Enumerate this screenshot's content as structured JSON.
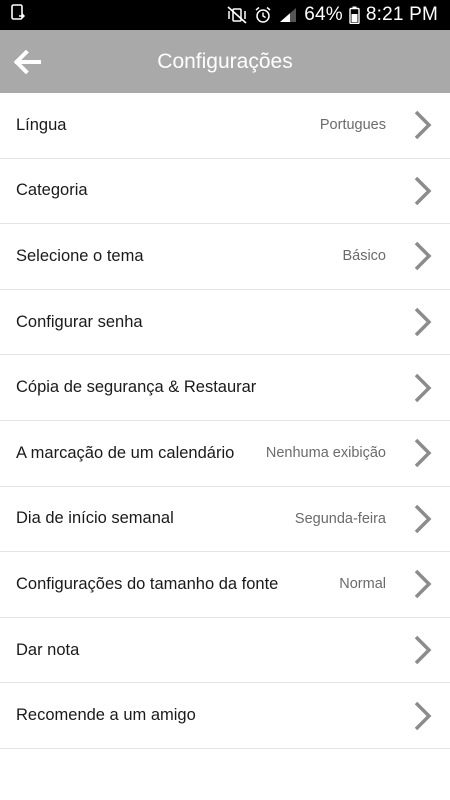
{
  "status_bar": {
    "battery_text": "64%",
    "time": "8:21 PM",
    "icons": [
      "screen-cast-icon",
      "mute-vibrate-icon",
      "alarm-icon",
      "signal-icon",
      "battery-icon"
    ]
  },
  "header": {
    "title": "Configurações",
    "back_icon": "arrow-left-icon",
    "background_color": "#a9a9a9"
  },
  "settings": {
    "items": [
      {
        "label": "Língua",
        "value": "Portugues"
      },
      {
        "label": "Categoria",
        "value": ""
      },
      {
        "label": "Selecione o tema",
        "value": "Básico"
      },
      {
        "label": "Configurar senha",
        "value": ""
      },
      {
        "label": "Cópia de segurança & Restaurar",
        "value": ""
      },
      {
        "label": "A marcação de um calendário",
        "value": "Nenhuma exibição"
      },
      {
        "label": "Dia de início semanal",
        "value": "Segunda-feira"
      },
      {
        "label": "Configurações do tamanho da fonte",
        "value": "Normal"
      },
      {
        "label": "Dar nota",
        "value": ""
      },
      {
        "label": "Recomende a um amigo",
        "value": ""
      }
    ],
    "chevron_icon": "chevron-right-icon"
  }
}
